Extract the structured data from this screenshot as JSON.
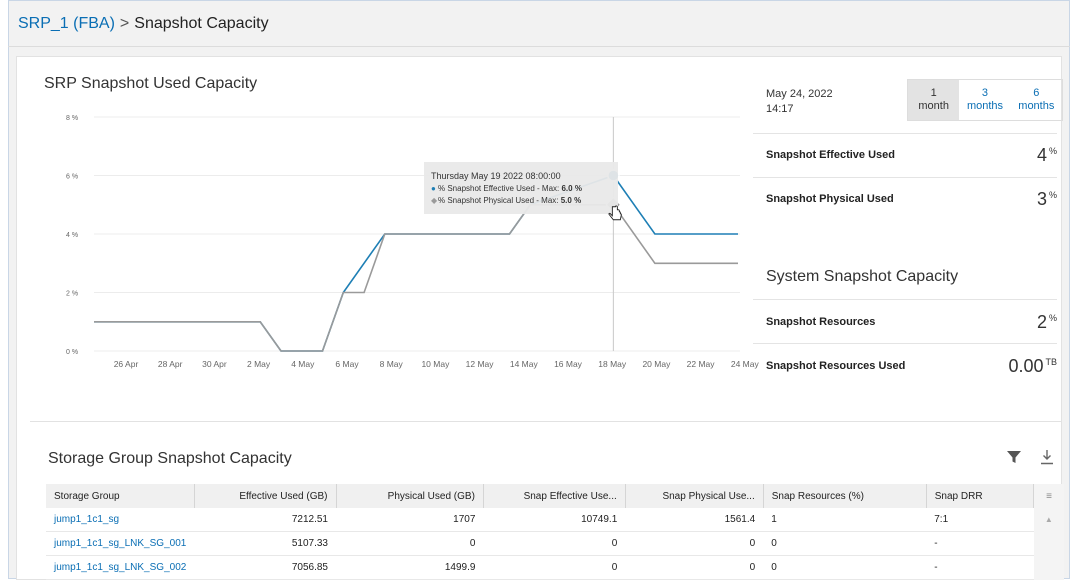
{
  "breadcrumb": {
    "parent": "SRP_1 (FBA)",
    "separator": ">",
    "current": "Snapshot Capacity"
  },
  "chart_section": {
    "title": "SRP Snapshot Used Capacity"
  },
  "chart_data": {
    "type": "line",
    "y_ticks": [
      "0 %",
      "2 %",
      "4 %",
      "6 %",
      "8 %"
    ],
    "ylim": [
      0,
      8
    ],
    "x_ticks": [
      "26 Apr",
      "28 Apr",
      "30 Apr",
      "2 May",
      "4 May",
      "6 May",
      "8 May",
      "10 May",
      "12 May",
      "14 May",
      "16 May",
      "18 May",
      "20 May",
      "22 May",
      "24 May"
    ],
    "series": [
      {
        "name": "% Snapshot Effective Used",
        "color": "#1e7fb5",
        "points": [
          [
            "04-24",
            1
          ],
          [
            "05-02",
            1
          ],
          [
            "05-03",
            0
          ],
          [
            "05-05",
            0
          ],
          [
            "05-06",
            2
          ],
          [
            "05-08",
            4
          ],
          [
            "05-14",
            4
          ],
          [
            "05-15",
            5
          ],
          [
            "05-19",
            6
          ],
          [
            "05-21",
            4
          ],
          [
            "05-25",
            4
          ]
        ]
      },
      {
        "name": "% Snapshot Physical Used",
        "color": "#9a9a9a",
        "points": [
          [
            "04-24",
            1
          ],
          [
            "05-02",
            1
          ],
          [
            "05-03",
            0
          ],
          [
            "05-05",
            0
          ],
          [
            "05-06",
            2
          ],
          [
            "05-07",
            2
          ],
          [
            "05-08",
            4
          ],
          [
            "05-14",
            4
          ],
          [
            "05-15",
            5
          ],
          [
            "05-19",
            5
          ],
          [
            "05-21",
            3
          ],
          [
            "05-25",
            3
          ]
        ]
      }
    ],
    "tooltip": {
      "title": "Thursday May 19 2022 08:00:00",
      "lines": [
        {
          "label": "% Snapshot Effective Used - Max:",
          "value": "6.0 %"
        },
        {
          "label": "% Snapshot Physical Used - Max:",
          "value": "5.0 %"
        }
      ]
    }
  },
  "summary": {
    "date": "May 24, 2022",
    "time": "14:17",
    "ranges": [
      {
        "n": "1",
        "unit": "month",
        "active": true
      },
      {
        "n": "3",
        "unit": "months",
        "active": false
      },
      {
        "n": "6",
        "unit": "months",
        "active": false
      }
    ],
    "metrics": [
      {
        "label": "Snapshot Effective Used",
        "value": "4",
        "unit": "%"
      },
      {
        "label": "Snapshot Physical Used",
        "value": "3",
        "unit": "%"
      }
    ],
    "system_title": "System Snapshot Capacity",
    "system_metrics": [
      {
        "label": "Snapshot Resources",
        "value": "2",
        "unit": "%"
      },
      {
        "label": "Snapshot Resources Used",
        "value": "0.00",
        "unit": "TB"
      }
    ]
  },
  "sg_table": {
    "title": "Storage Group Snapshot Capacity",
    "columns": [
      "Storage Group",
      "Effective Used (GB)",
      "Physical Used (GB)",
      "Snap Effective Use...",
      "Snap Physical Use...",
      "Snap Resources (%)",
      "Snap DRR"
    ],
    "rows": [
      [
        "jump1_1c1_sg",
        "7212.51",
        "1707",
        "10749.1",
        "1561.4",
        "1",
        "7:1"
      ],
      [
        "jump1_1c1_sg_LNK_SG_001",
        "5107.33",
        "0",
        "0",
        "0",
        "0",
        "-"
      ],
      [
        "jump1_1c1_sg_LNK_SG_002",
        "7056.85",
        "1499.9",
        "0",
        "0",
        "0",
        "-"
      ]
    ]
  }
}
